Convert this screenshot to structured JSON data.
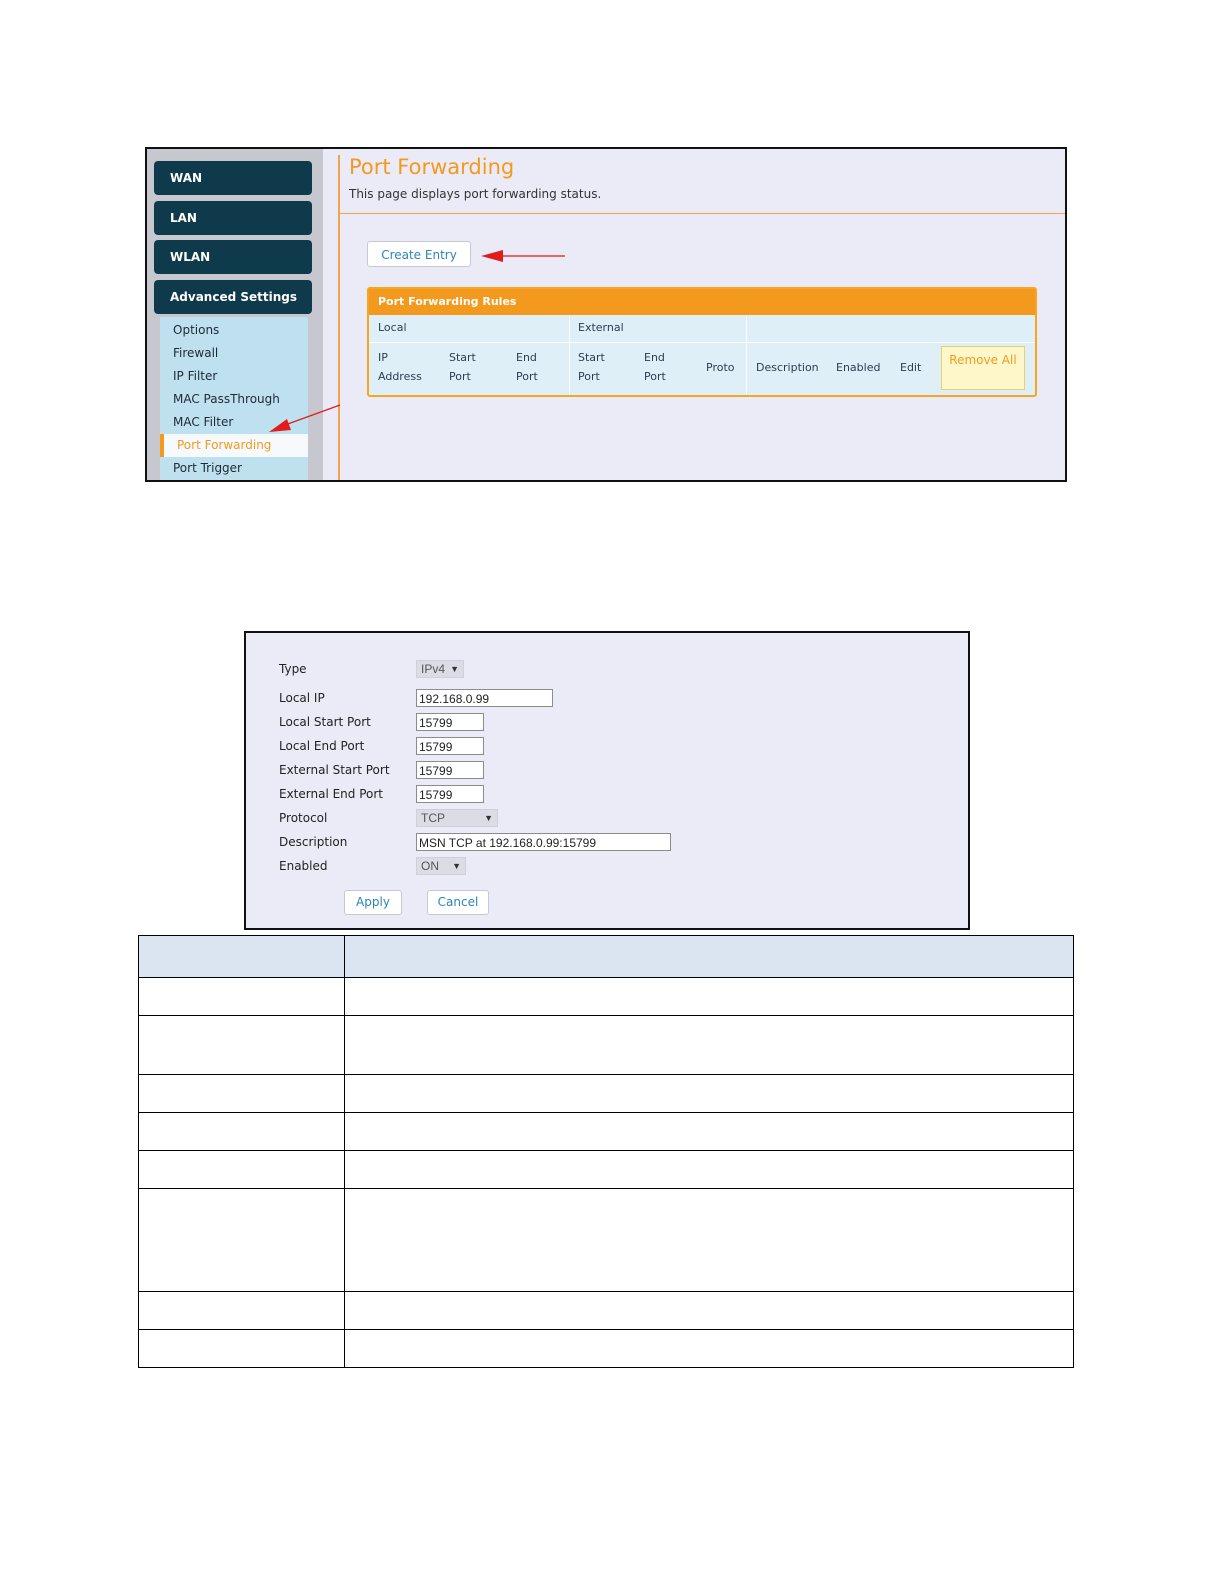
{
  "screen1": {
    "sidebar": {
      "main_items": [
        "WAN",
        "LAN",
        "WLAN",
        "Advanced Settings"
      ],
      "sub_items": [
        "Options",
        "Firewall",
        "IP Filter",
        "MAC PassThrough",
        "MAC Filter",
        "Port Forwarding",
        "Port Trigger"
      ],
      "active_sub_item": "Port Forwarding"
    },
    "title": "Port Forwarding",
    "description": "This page displays port forwarding status.",
    "create_entry_label": "Create Entry",
    "rules": {
      "heading": "Port Forwarding Rules",
      "groups": {
        "local": "Local",
        "external": "External"
      },
      "columns": [
        "IP Address",
        "Start Port",
        "End Port",
        "Start Port",
        "End Port",
        "Proto",
        "Description",
        "Enabled",
        "Edit"
      ],
      "remove_all_label": "Remove All"
    },
    "accent_color": "#f39a1e",
    "nav_color": "#0f3a4b"
  },
  "screen2": {
    "fields": {
      "type": {
        "label": "Type",
        "value": "IPv4"
      },
      "local_ip": {
        "label": "Local IP",
        "value": "192.168.0.99"
      },
      "local_start_port": {
        "label": "Local Start Port",
        "value": "15799"
      },
      "local_end_port": {
        "label": "Local End Port",
        "value": "15799"
      },
      "external_start_port": {
        "label": "External Start Port",
        "value": "15799"
      },
      "external_end_port": {
        "label": "External End Port",
        "value": "15799"
      },
      "protocol": {
        "label": "Protocol",
        "value": "TCP"
      },
      "description": {
        "label": "Description",
        "value": "MSN TCP at 192.168.0.99:15799"
      },
      "enabled": {
        "label": "Enabled",
        "value": "ON"
      }
    },
    "apply_label": "Apply",
    "cancel_label": "Cancel"
  },
  "table": {
    "rows": 10,
    "header_color": "#dbe5f1"
  }
}
